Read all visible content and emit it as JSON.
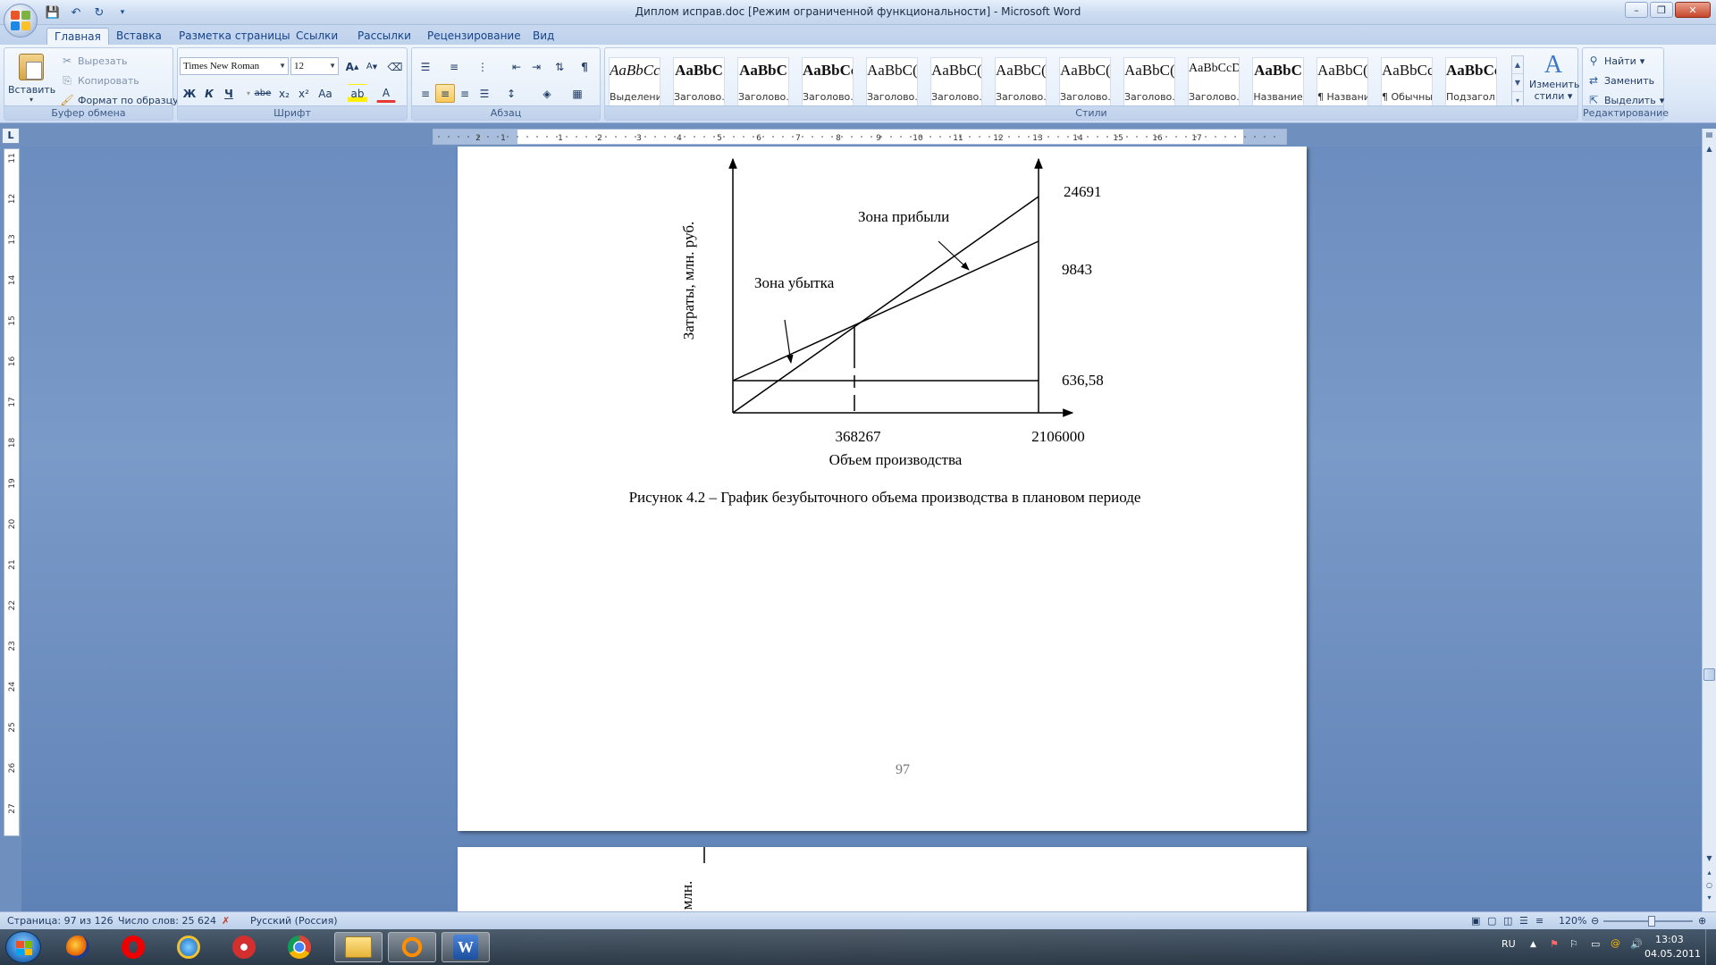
{
  "window": {
    "title": "Диплом исправ.doc [Режим ограниченной функциональности] - Microsoft Word",
    "min_label": "–",
    "max_label": "❐",
    "close_label": "✕"
  },
  "tabs": [
    "Главная",
    "Вставка",
    "Разметка страницы",
    "Ссылки",
    "Рассылки",
    "Рецензирование",
    "Вид"
  ],
  "clipboard": {
    "paste": "Вставить",
    "cut": "Вырезать",
    "copy": "Копировать",
    "format_painter": "Формат по образцу",
    "label": "Буфер обмена"
  },
  "font": {
    "name": "Times New Roman",
    "size": "12",
    "label": "Шрифт",
    "bold": "Ж",
    "italic": "К",
    "underline": "Ч",
    "strike": "abe",
    "subscript": "x₂",
    "superscript": "x²",
    "case": "Aa",
    "grow": "A",
    "shrink": "A",
    "color_letter": "A"
  },
  "paragraph": {
    "label": "Абзац",
    "pilcrow": "¶"
  },
  "styles": {
    "label": "Стили",
    "items": [
      {
        "sample": "AaBbCcI",
        "name": "Выделение"
      },
      {
        "sample": "AaBbC",
        "name": "Заголово..."
      },
      {
        "sample": "AaBbC",
        "name": "Заголово..."
      },
      {
        "sample": "AaBbCc",
        "name": "Заголово..."
      },
      {
        "sample": "AaBbC(",
        "name": "Заголово..."
      },
      {
        "sample": "AaBbC(",
        "name": "Заголово..."
      },
      {
        "sample": "AaBbC(",
        "name": "Заголово..."
      },
      {
        "sample": "AaBbC(",
        "name": "Заголово..."
      },
      {
        "sample": "AaBbC(",
        "name": "Заголово..."
      },
      {
        "sample": "AaBbCcD",
        "name": "Заголово..."
      },
      {
        "sample": "AaBbC",
        "name": "Название"
      },
      {
        "sample": "AaBbC(",
        "name": "¶ Названи..."
      },
      {
        "sample": "AaBbCcI",
        "name": "¶ Обычный"
      },
      {
        "sample": "AaBbCcl",
        "name": "Подзагол..."
      }
    ],
    "change_styles": "Изменить",
    "change_styles_2": "стили"
  },
  "editing": {
    "label": "Редактирование",
    "find": "Найти",
    "replace": "Заменить",
    "select": "Выделить"
  },
  "ruler": {
    "corner": "L",
    "h_ticks": [
      "2",
      "1",
      "1",
      "2",
      "3",
      "4",
      "5",
      "6",
      "7",
      "8",
      "9",
      "10",
      "11",
      "12",
      "13",
      "14",
      "15",
      "16",
      "17"
    ],
    "v_ticks": [
      "11",
      "12",
      "13",
      "14",
      "15",
      "16",
      "17",
      "18",
      "19",
      "20",
      "21",
      "22",
      "23",
      "24",
      "25",
      "26",
      "27"
    ]
  },
  "document": {
    "caption": "Рисунок 4.2 – График безубыточного объема производства в плановом периоде",
    "page_number": "97",
    "next_page_fragment": "ы, млн."
  },
  "chart_data": {
    "type": "line",
    "title": "",
    "xlabel": "Объем производства",
    "ylabel": "Затраты, млн. руб.",
    "x_tick_labels": [
      "368267",
      "2106000"
    ],
    "y_end_labels": [
      "24691",
      "9843",
      "636,58"
    ],
    "annotations": [
      "Зона прибыли",
      "Зона убытка"
    ],
    "break_even_x": 368267,
    "max_x": 2106000,
    "series": [
      {
        "x": [
          0,
          2106000
        ],
        "y": [
          0,
          24691
        ]
      },
      {
        "x": [
          0,
          2106000
        ],
        "y": [
          636.58,
          9843
        ]
      },
      {
        "x": [
          0,
          2106000
        ],
        "y": [
          636.58,
          636.58
        ]
      }
    ]
  },
  "status": {
    "page": "Страница: 97 из 126",
    "words": "Число слов: 25 624",
    "language": "Русский (Россия)",
    "zoom": "120%"
  },
  "taskbar": {
    "lang": "RU",
    "time": "13:03",
    "date": "04.05.2011"
  }
}
